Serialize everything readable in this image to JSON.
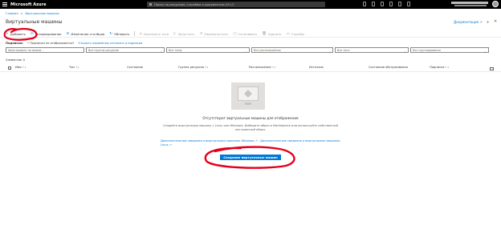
{
  "topbar": {
    "brand": "Microsoft Azure",
    "search_placeholder": "Поиск по ресурсам, службам и документам (G+/)"
  },
  "breadcrumb": {
    "home": "Главная",
    "sep": ">",
    "current": "Виртуальные машины"
  },
  "page": {
    "title": "Виртуальные машины",
    "doc_link": "Документация ↗",
    "pin": "✢",
    "close": "✕"
  },
  "toolbar": {
    "add": "Добавить",
    "reserve": "Резервирование",
    "edit_columns": "Изменение столбцов",
    "refresh": "Обновить",
    "assign_tags": "Назначить теги",
    "start": "Запустить",
    "restart": "Перезапустить",
    "stop": "Остановить",
    "delete": "Удалить",
    "services": "Службы"
  },
  "subscriptions": {
    "label": "Подписки:",
    "warning": "Подписки не отображаются?",
    "link": "Открыть параметры каталога и подписки"
  },
  "filters": {
    "name_placeholder": "Фильтровать по имени...",
    "resource_groups": "Все группы ресурсов",
    "types": "Все типы",
    "locations": "Все расположения",
    "tags": "Все теги",
    "grouping": "Без группирования"
  },
  "count_label": "Элементов: 0",
  "columns": [
    "Имя",
    "Тип",
    "Состояние",
    "Группа ресурсов",
    "Расположение",
    "Источник",
    "Состояние обслуживания",
    "Подписка"
  ],
  "empty": {
    "message": "Отсутствуют виртуальные машины для отображения",
    "description": "Создайте виртуальную машину с Linux или Windows. Выберите образ в Marketplace или используйте собственный настроенный образ.",
    "link_windows": "Дополнительные сведения о виртуальных машинах Windows ↗",
    "link_sep": " · ",
    "link_linux": "Дополнительные сведения о виртуальных машинах Linux ↗",
    "create_button": "Создание виртуальных машин"
  },
  "colors": {
    "accent": "#0078d4",
    "topbar": "#000000",
    "annotation": "#e3001b"
  }
}
